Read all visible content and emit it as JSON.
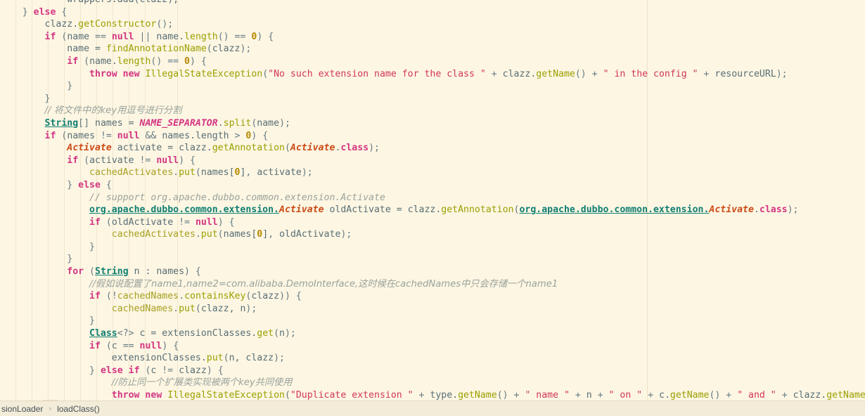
{
  "editor": {
    "name": "code-editor",
    "theme_background": "#fdf6e3",
    "language": "Java"
  },
  "breadcrumb": {
    "items": [
      {
        "label": "sionLoader",
        "truncated": true
      },
      {
        "label": "loadClass()",
        "truncated": false
      }
    ],
    "separator": "›"
  },
  "code": {
    "lines": [
      [
        {
          "t": "plain",
          "s": "            "
        },
        {
          "t": "clipped",
          "s": "wrappers.add(clazz);"
        }
      ],
      [
        {
          "t": "plain",
          "s": "    "
        },
        {
          "t": "punct",
          "s": "} "
        },
        {
          "t": "kw",
          "s": "else"
        },
        {
          "t": "punct",
          "s": " {"
        }
      ],
      [
        {
          "t": "plain",
          "s": "        "
        },
        {
          "t": "ident",
          "s": "clazz."
        },
        {
          "t": "method",
          "s": "getConstructor"
        },
        {
          "t": "punct",
          "s": "();"
        }
      ],
      [
        {
          "t": "plain",
          "s": "        "
        },
        {
          "t": "kw",
          "s": "if"
        },
        {
          "t": "punct",
          "s": " ("
        },
        {
          "t": "ident",
          "s": "name"
        },
        {
          "t": "punct",
          "s": " == "
        },
        {
          "t": "kw",
          "s": "null"
        },
        {
          "t": "punct",
          "s": " || "
        },
        {
          "t": "ident",
          "s": "name."
        },
        {
          "t": "method",
          "s": "length"
        },
        {
          "t": "punct",
          "s": "() == "
        },
        {
          "t": "num",
          "s": "0"
        },
        {
          "t": "punct",
          "s": ") {"
        }
      ],
      [
        {
          "t": "plain",
          "s": "            "
        },
        {
          "t": "ident",
          "s": "name = "
        },
        {
          "t": "method",
          "s": "findAnnotationName"
        },
        {
          "t": "punct",
          "s": "("
        },
        {
          "t": "ident",
          "s": "clazz"
        },
        {
          "t": "punct",
          "s": ");"
        }
      ],
      [
        {
          "t": "plain",
          "s": "            "
        },
        {
          "t": "kw",
          "s": "if"
        },
        {
          "t": "punct",
          "s": " ("
        },
        {
          "t": "ident",
          "s": "name."
        },
        {
          "t": "method",
          "s": "length"
        },
        {
          "t": "punct",
          "s": "() == "
        },
        {
          "t": "num",
          "s": "0"
        },
        {
          "t": "punct",
          "s": ") {"
        }
      ],
      [
        {
          "t": "plain",
          "s": "                "
        },
        {
          "t": "kw",
          "s": "throw new"
        },
        {
          "t": "plain",
          "s": " "
        },
        {
          "t": "method",
          "s": "IllegalStateException"
        },
        {
          "t": "punct",
          "s": "("
        },
        {
          "t": "str",
          "s": "\"No such extension name for the class \""
        },
        {
          "t": "punct",
          "s": " + "
        },
        {
          "t": "ident",
          "s": "clazz."
        },
        {
          "t": "method",
          "s": "getName"
        },
        {
          "t": "punct",
          "s": "() + "
        },
        {
          "t": "str",
          "s": "\" in the config \""
        },
        {
          "t": "punct",
          "s": " + "
        },
        {
          "t": "ident",
          "s": "resourceURL"
        },
        {
          "t": "punct",
          "s": ");"
        }
      ],
      [
        {
          "t": "plain",
          "s": "            "
        },
        {
          "t": "punct",
          "s": "}"
        }
      ],
      [
        {
          "t": "plain",
          "s": "        "
        },
        {
          "t": "punct",
          "s": "}"
        }
      ],
      [
        {
          "t": "plain",
          "s": "        "
        },
        {
          "t": "comment",
          "s": "// 将文件中的key用逗号进行分割"
        }
      ],
      [
        {
          "t": "plain",
          "s": "        "
        },
        {
          "t": "type",
          "s": "String"
        },
        {
          "t": "punct",
          "s": "[] "
        },
        {
          "t": "ident",
          "s": "names = "
        },
        {
          "t": "static",
          "s": "NAME_SEPARATOR"
        },
        {
          "t": "punct",
          "s": "."
        },
        {
          "t": "method",
          "s": "split"
        },
        {
          "t": "punct",
          "s": "("
        },
        {
          "t": "ident",
          "s": "name"
        },
        {
          "t": "punct",
          "s": ");"
        }
      ],
      [
        {
          "t": "plain",
          "s": "        "
        },
        {
          "t": "kw",
          "s": "if"
        },
        {
          "t": "punct",
          "s": " ("
        },
        {
          "t": "ident",
          "s": "names"
        },
        {
          "t": "punct",
          "s": " != "
        },
        {
          "t": "kw",
          "s": "null"
        },
        {
          "t": "punct",
          "s": " && "
        },
        {
          "t": "ident",
          "s": "names.length"
        },
        {
          "t": "punct",
          "s": " > "
        },
        {
          "t": "num",
          "s": "0"
        },
        {
          "t": "punct",
          "s": ") {"
        }
      ],
      [
        {
          "t": "plain",
          "s": "            "
        },
        {
          "t": "anno",
          "s": "Activate"
        },
        {
          "t": "ident",
          "s": " activate = clazz."
        },
        {
          "t": "method",
          "s": "getAnnotation"
        },
        {
          "t": "punct",
          "s": "("
        },
        {
          "t": "anno",
          "s": "Activate"
        },
        {
          "t": "punct",
          "s": "."
        },
        {
          "t": "kw",
          "s": "class"
        },
        {
          "t": "punct",
          "s": ");"
        }
      ],
      [
        {
          "t": "plain",
          "s": "            "
        },
        {
          "t": "kw",
          "s": "if"
        },
        {
          "t": "punct",
          "s": " ("
        },
        {
          "t": "ident",
          "s": "activate"
        },
        {
          "t": "punct",
          "s": " != "
        },
        {
          "t": "kw",
          "s": "null"
        },
        {
          "t": "punct",
          "s": ") {"
        }
      ],
      [
        {
          "t": "plain",
          "s": "                "
        },
        {
          "t": "field",
          "s": "cachedActivates"
        },
        {
          "t": "punct",
          "s": "."
        },
        {
          "t": "method",
          "s": "put"
        },
        {
          "t": "punct",
          "s": "("
        },
        {
          "t": "ident",
          "s": "names["
        },
        {
          "t": "num",
          "s": "0"
        },
        {
          "t": "ident",
          "s": "]"
        },
        {
          "t": "punct",
          "s": ", "
        },
        {
          "t": "ident",
          "s": "activate"
        },
        {
          "t": "punct",
          "s": ");"
        }
      ],
      [
        {
          "t": "plain",
          "s": "            "
        },
        {
          "t": "punct",
          "s": "} "
        },
        {
          "t": "kw",
          "s": "else"
        },
        {
          "t": "punct",
          "s": " {"
        }
      ],
      [
        {
          "t": "plain",
          "s": "                "
        },
        {
          "t": "comment",
          "s": "// support org.apache.dubbo.common.extension.Activate"
        }
      ],
      [
        {
          "t": "plain",
          "s": "                "
        },
        {
          "t": "pkg",
          "s": "org.apache.dubbo.common.extension."
        },
        {
          "t": "anno",
          "s": "Activate"
        },
        {
          "t": "ident",
          "s": " oldActivate = clazz."
        },
        {
          "t": "method",
          "s": "getAnnotation"
        },
        {
          "t": "punct",
          "s": "("
        },
        {
          "t": "pkg",
          "s": "org.apache.dubbo.common.extension."
        },
        {
          "t": "anno",
          "s": "Activate"
        },
        {
          "t": "punct",
          "s": "."
        },
        {
          "t": "kw",
          "s": "class"
        },
        {
          "t": "punct",
          "s": ");"
        }
      ],
      [
        {
          "t": "plain",
          "s": "                "
        },
        {
          "t": "kw",
          "s": "if"
        },
        {
          "t": "punct",
          "s": " ("
        },
        {
          "t": "ident",
          "s": "oldActivate"
        },
        {
          "t": "punct",
          "s": " != "
        },
        {
          "t": "kw",
          "s": "null"
        },
        {
          "t": "punct",
          "s": ") {"
        }
      ],
      [
        {
          "t": "plain",
          "s": "                    "
        },
        {
          "t": "field",
          "s": "cachedActivates"
        },
        {
          "t": "punct",
          "s": "."
        },
        {
          "t": "method",
          "s": "put"
        },
        {
          "t": "punct",
          "s": "("
        },
        {
          "t": "ident",
          "s": "names["
        },
        {
          "t": "num",
          "s": "0"
        },
        {
          "t": "ident",
          "s": "]"
        },
        {
          "t": "punct",
          "s": ", "
        },
        {
          "t": "ident",
          "s": "oldActivate"
        },
        {
          "t": "punct",
          "s": ");"
        }
      ],
      [
        {
          "t": "plain",
          "s": "                "
        },
        {
          "t": "punct",
          "s": "}"
        }
      ],
      [
        {
          "t": "plain",
          "s": "            "
        },
        {
          "t": "punct",
          "s": "}"
        }
      ],
      [
        {
          "t": "plain",
          "s": "            "
        },
        {
          "t": "kw",
          "s": "for"
        },
        {
          "t": "punct",
          "s": " ("
        },
        {
          "t": "type",
          "s": "String"
        },
        {
          "t": "ident",
          "s": " n : names"
        },
        {
          "t": "punct",
          "s": ") {"
        }
      ],
      [
        {
          "t": "plain",
          "s": "                "
        },
        {
          "t": "comment",
          "s": "//假如说配置了name1,name2=com.alibaba.DemoInterface,这时候在cachedNames中只会存储一个name1"
        }
      ],
      [
        {
          "t": "plain",
          "s": "                "
        },
        {
          "t": "kw",
          "s": "if"
        },
        {
          "t": "punct",
          "s": " (!"
        },
        {
          "t": "field",
          "s": "cachedNames"
        },
        {
          "t": "punct",
          "s": "."
        },
        {
          "t": "method",
          "s": "containsKey"
        },
        {
          "t": "punct",
          "s": "("
        },
        {
          "t": "ident",
          "s": "clazz"
        },
        {
          "t": "punct",
          "s": ")) {"
        }
      ],
      [
        {
          "t": "plain",
          "s": "                    "
        },
        {
          "t": "field",
          "s": "cachedNames"
        },
        {
          "t": "punct",
          "s": "."
        },
        {
          "t": "method",
          "s": "put"
        },
        {
          "t": "punct",
          "s": "("
        },
        {
          "t": "ident",
          "s": "clazz, n"
        },
        {
          "t": "punct",
          "s": ");"
        }
      ],
      [
        {
          "t": "plain",
          "s": "                "
        },
        {
          "t": "punct",
          "s": "}"
        }
      ],
      [
        {
          "t": "plain",
          "s": "                "
        },
        {
          "t": "type",
          "s": "Class"
        },
        {
          "t": "punct",
          "s": "<?> "
        },
        {
          "t": "ident",
          "s": "c = extensionClasses."
        },
        {
          "t": "method",
          "s": "get"
        },
        {
          "t": "punct",
          "s": "("
        },
        {
          "t": "ident",
          "s": "n"
        },
        {
          "t": "punct",
          "s": ");"
        }
      ],
      [
        {
          "t": "plain",
          "s": "                "
        },
        {
          "t": "kw",
          "s": "if"
        },
        {
          "t": "punct",
          "s": " ("
        },
        {
          "t": "ident",
          "s": "c"
        },
        {
          "t": "punct",
          "s": " == "
        },
        {
          "t": "kw",
          "s": "null"
        },
        {
          "t": "punct",
          "s": ") {"
        }
      ],
      [
        {
          "t": "plain",
          "s": "                    "
        },
        {
          "t": "ident",
          "s": "extensionClasses."
        },
        {
          "t": "method",
          "s": "put"
        },
        {
          "t": "punct",
          "s": "("
        },
        {
          "t": "ident",
          "s": "n, clazz"
        },
        {
          "t": "punct",
          "s": ");"
        }
      ],
      [
        {
          "t": "plain",
          "s": "                "
        },
        {
          "t": "punct",
          "s": "} "
        },
        {
          "t": "kw",
          "s": "else if"
        },
        {
          "t": "punct",
          "s": " ("
        },
        {
          "t": "ident",
          "s": "c"
        },
        {
          "t": "punct",
          "s": " != "
        },
        {
          "t": "ident",
          "s": "clazz"
        },
        {
          "t": "punct",
          "s": ") {"
        }
      ],
      [
        {
          "t": "plain",
          "s": "                    "
        },
        {
          "t": "comment",
          "s": "//防止同一个扩展类实现被两个key共同使用"
        }
      ],
      [
        {
          "t": "plain",
          "s": "                    "
        },
        {
          "t": "kw",
          "s": "throw new"
        },
        {
          "t": "plain",
          "s": " "
        },
        {
          "t": "method",
          "s": "IllegalStateException"
        },
        {
          "t": "punct",
          "s": "("
        },
        {
          "t": "str",
          "s": "\"Duplicate extension \""
        },
        {
          "t": "punct",
          "s": " + "
        },
        {
          "t": "ident",
          "s": "type."
        },
        {
          "t": "method",
          "s": "getName"
        },
        {
          "t": "punct",
          "s": "() + "
        },
        {
          "t": "str",
          "s": "\" name \""
        },
        {
          "t": "punct",
          "s": " + "
        },
        {
          "t": "ident",
          "s": "n"
        },
        {
          "t": "punct",
          "s": " + "
        },
        {
          "t": "str",
          "s": "\" on \""
        },
        {
          "t": "punct",
          "s": " + "
        },
        {
          "t": "ident",
          "s": "c."
        },
        {
          "t": "method",
          "s": "getName"
        },
        {
          "t": "punct",
          "s": "() + "
        },
        {
          "t": "str",
          "s": "\" and \""
        },
        {
          "t": "punct",
          "s": " + "
        },
        {
          "t": "ident",
          "s": "clazz."
        },
        {
          "t": "method",
          "s": "getName"
        }
      ],
      [
        {
          "t": "plain",
          "s": "                "
        },
        {
          "t": "punct",
          "s": "}"
        }
      ]
    ],
    "indent_guide_positions": [
      22,
      45,
      68,
      91,
      114,
      137,
      160,
      183,
      206,
      252
    ],
    "right_margin_x": 920
  }
}
